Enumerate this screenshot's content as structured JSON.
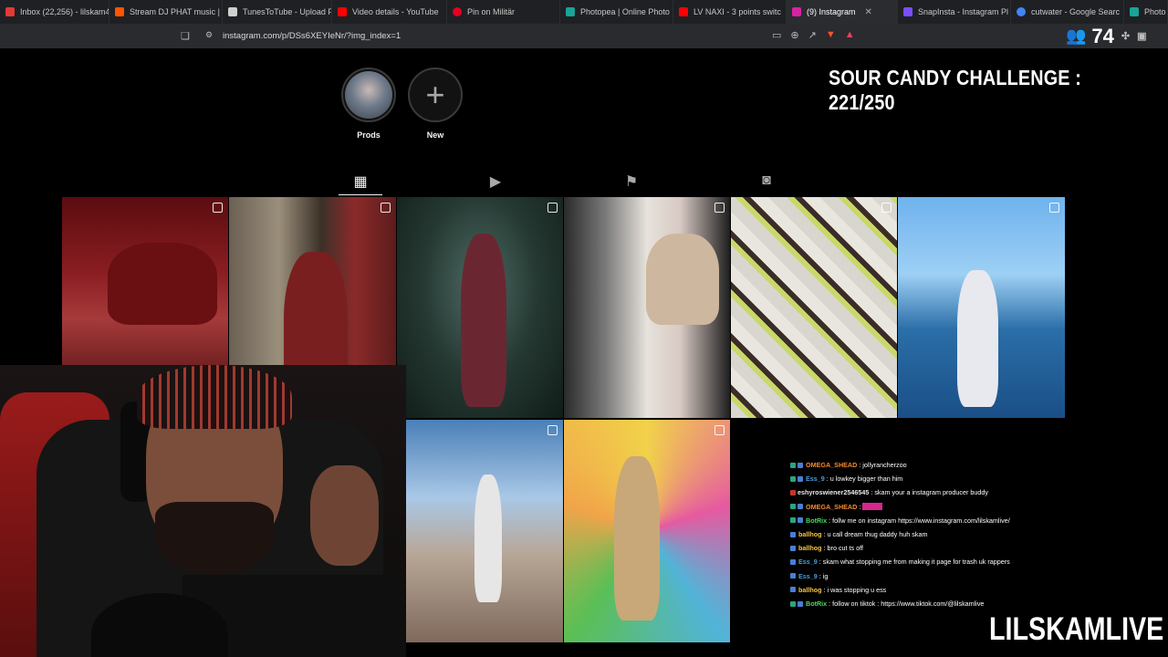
{
  "browser": {
    "tabs": [
      {
        "label": "Inbox (22,256) - lilskam4",
        "color": "#e53935"
      },
      {
        "label": "Stream DJ PHAT music |",
        "color": "#ff5500"
      },
      {
        "label": "TunesToTube - Upload F",
        "color": "#cfcfcf"
      },
      {
        "label": "Video details - YouTube",
        "color": "#ff0000"
      },
      {
        "label": "Pin on Militär",
        "color": "#e60023"
      },
      {
        "label": "Photopea | Online Photo",
        "color": "#18a497"
      },
      {
        "label": "LV NAXI - 3 points switc",
        "color": "#ff0000"
      },
      {
        "label": "(9) Instagram",
        "color": "#d6249f",
        "active": true
      },
      {
        "label": "SnapInsta - Instagram Pl",
        "color": "#7c4dff"
      },
      {
        "label": "cutwater - Google Searc",
        "color": "#4285f4"
      },
      {
        "label": "Photo",
        "color": "#18a497"
      }
    ],
    "url": "instagram.com/p/DSs6XEYIeNr/?img_index=1"
  },
  "overlay": {
    "viewer_count": "74",
    "challenge": "SOUR CANDY CHALLENGE : 221/250",
    "watermark": "LILSKAMLIVE"
  },
  "highlights": [
    {
      "label": "Prods"
    },
    {
      "label": "New"
    }
  ],
  "profile_tabs": [
    "grid-icon",
    "reels-icon",
    "saved-icon",
    "tagged-icon"
  ],
  "chat": [
    {
      "user": "OMEGA_SHEAD",
      "color": "#f58a2e",
      "text": ": jollyrancherzoo",
      "badge": "mod"
    },
    {
      "user": "Ess_9",
      "color": "#4a9fd8",
      "text": ": u lowkey bigger than him",
      "badge": "mod"
    },
    {
      "user": "eshyroswiener2546545",
      "color": "#e8e8e8",
      "text": ": skam your a instagram producer buddy",
      "badge": "sub"
    },
    {
      "user": "OMEGA_SHEAD",
      "color": "#f58a2e",
      "text": ":",
      "badge": "mod",
      "redacted": true
    },
    {
      "user": "BotRix",
      "color": "#4cd964",
      "text": ": follw me on instagram https://www.instagram.com/lilskamlive/",
      "badge": "mod"
    },
    {
      "user": "ballhog",
      "color": "#f5c542",
      "text": ": u call dream thug daddy huh skam",
      "badge": "mod"
    },
    {
      "user": "ballhog",
      "color": "#f5c542",
      "text": ": bro cut ts off",
      "badge": "mod"
    },
    {
      "user": "Ess_9",
      "color": "#4a9fd8",
      "text": ": skam what stopping me from making it page for trash uk rappers",
      "badge": "mod"
    },
    {
      "user": "Ess_9",
      "color": "#4a9fd8",
      "text": ": ig",
      "badge": "mod"
    },
    {
      "user": "ballhog",
      "color": "#f5c542",
      "text": ": i was stopping u ess",
      "badge": "mod"
    },
    {
      "user": "BotRix",
      "color": "#4cd964",
      "text": ": follow on tiktok : https://www.tiktok.com/@lilskamlive",
      "badge": "mod"
    }
  ]
}
